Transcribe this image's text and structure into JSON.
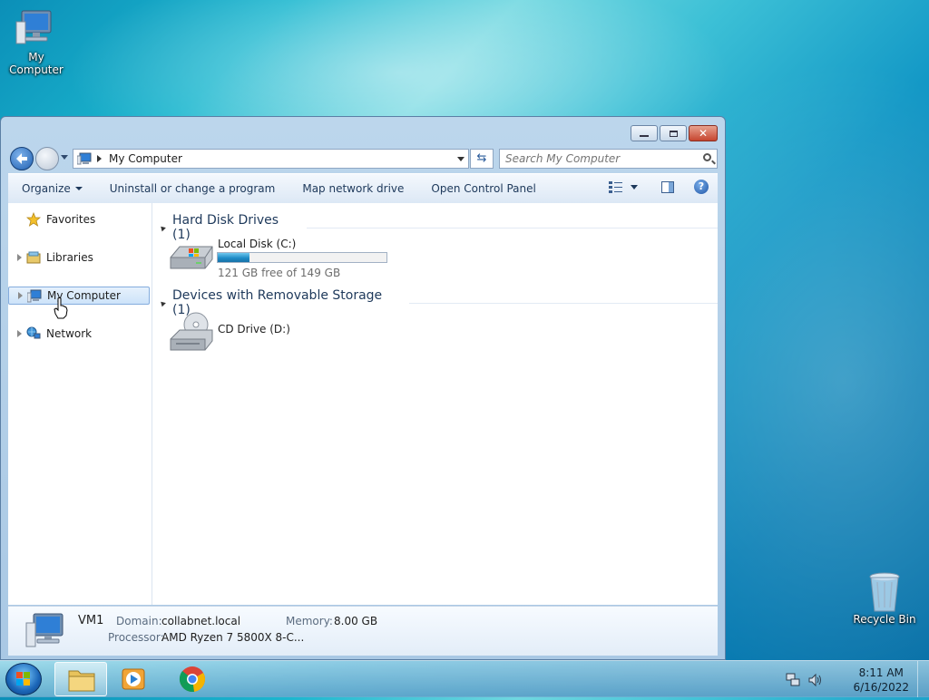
{
  "desktop": {
    "icons": [
      {
        "label": "My Computer"
      },
      {
        "label": "Recycle Bin"
      }
    ]
  },
  "window": {
    "address": {
      "path": "My Computer"
    },
    "search": {
      "placeholder": "Search My Computer"
    },
    "toolbar": {
      "organize": "Organize",
      "uninstall": "Uninstall or change a program",
      "map_drive": "Map network drive",
      "control_panel": "Open Control Panel"
    },
    "nav": {
      "items": [
        {
          "label": "Favorites"
        },
        {
          "label": "Libraries"
        },
        {
          "label": "My Computer",
          "selected": true
        },
        {
          "label": "Network"
        }
      ]
    },
    "groups": [
      {
        "title": "Hard Disk Drives (1)",
        "items": [
          {
            "name": "Local Disk (C:)",
            "free_text": "121 GB free of 149 GB",
            "used_fraction": 0.19
          }
        ]
      },
      {
        "title": "Devices with Removable Storage (1)",
        "items": [
          {
            "name": "CD Drive (D:)"
          }
        ]
      }
    ],
    "details": {
      "computer_name": "VM1",
      "domain_label": "Domain:",
      "domain_value": "collabnet.local",
      "memory_label": "Memory:",
      "memory_value": "8.00 GB",
      "processor_label": "Processor:",
      "processor_value": "AMD Ryzen 7 5800X 8-C..."
    }
  },
  "taskbar": {
    "pinned": [
      "windows-explorer",
      "media-player",
      "chrome"
    ],
    "clock": {
      "time": "8:11 AM",
      "date": "6/16/2022"
    }
  },
  "colors": {
    "accent": "#1e395b",
    "selection": "#cde3f9",
    "progress": "#1f8cc7"
  }
}
